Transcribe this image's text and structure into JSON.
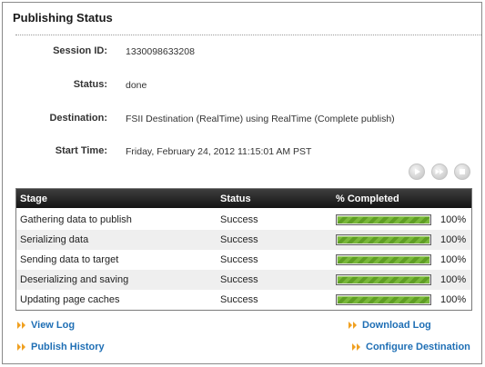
{
  "panel": {
    "title": "Publishing Status"
  },
  "info": [
    {
      "label": "Session ID:",
      "value": "1330098633208"
    },
    {
      "label": "Status:",
      "value": "done"
    },
    {
      "label": "Destination:",
      "value": "FSII Destination (RealTime) using RealTime (Complete publish)"
    },
    {
      "label": "Start Time:",
      "value": "Friday, February 24, 2012 11:15:01 AM PST"
    }
  ],
  "controls": [
    "play-icon",
    "fast-forward-icon",
    "stop-icon"
  ],
  "table": {
    "headers": [
      "Stage",
      "Status",
      "% Completed"
    ],
    "rows": [
      {
        "stage": "Gathering data to publish",
        "status": "Success",
        "progress": 100,
        "percent": "100%"
      },
      {
        "stage": "Serializing data",
        "status": "Success",
        "progress": 100,
        "percent": "100%"
      },
      {
        "stage": "Sending data to target",
        "status": "Success",
        "progress": 100,
        "percent": "100%"
      },
      {
        "stage": "Deserializing and saving",
        "status": "Success",
        "progress": 100,
        "percent": "100%"
      },
      {
        "stage": "Updating page caches",
        "status": "Success",
        "progress": 100,
        "percent": "100%"
      }
    ]
  },
  "links": {
    "view_log": "View Log",
    "download_log": "Download Log",
    "publish_history": "Publish History",
    "configure_destination": "Configure Destination"
  },
  "colors": {
    "link": "#1f6fb5",
    "link_arrow": "#f0a020",
    "progress": "#6aab2e",
    "header_bg": "#222222"
  }
}
